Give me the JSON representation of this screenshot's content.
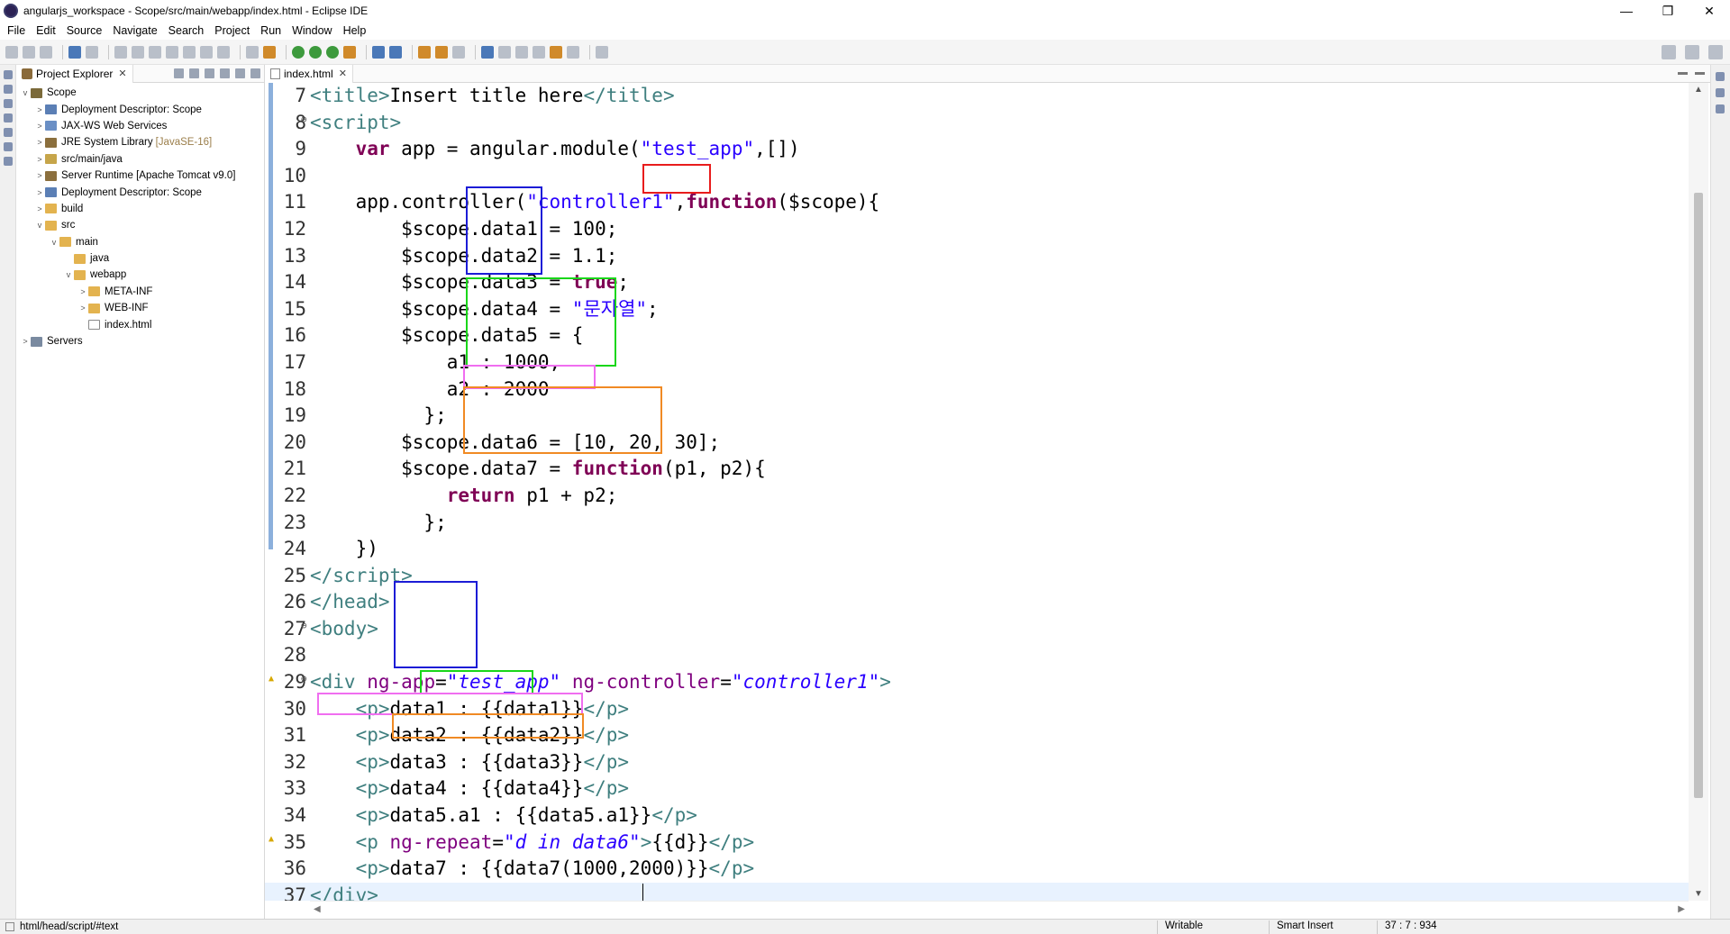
{
  "window": {
    "title": "angularjs_workspace - Scope/src/main/webapp/index.html - Eclipse IDE",
    "controls": [
      "minimize-icon",
      "restore-icon",
      "close-icon"
    ]
  },
  "menu": [
    "File",
    "Edit",
    "Source",
    "Navigate",
    "Search",
    "Project",
    "Run",
    "Window",
    "Help"
  ],
  "explorer": {
    "tab_label": "Project Explorer",
    "tree": [
      {
        "label": "Scope",
        "icon": "project-icon",
        "depth": 0,
        "expand": "v"
      },
      {
        "label": "Deployment Descriptor: Scope",
        "icon": "descriptor-icon",
        "depth": 1,
        "expand": ">"
      },
      {
        "label": "JAX-WS Web Services",
        "icon": "webservice-icon",
        "depth": 1,
        "expand": ">"
      },
      {
        "label": "JRE System Library",
        "suffix": "[JavaSE-16]",
        "icon": "library-icon",
        "depth": 1,
        "expand": ">"
      },
      {
        "label": "src/main/java",
        "icon": "source-folder-icon",
        "depth": 1,
        "expand": ">"
      },
      {
        "label": "Server Runtime [Apache Tomcat v9.0]",
        "icon": "library-icon",
        "depth": 1,
        "expand": ">"
      },
      {
        "label": "Deployment Descriptor: Scope",
        "icon": "descriptor-icon",
        "depth": 1,
        "expand": ">"
      },
      {
        "label": "build",
        "icon": "folder-icon",
        "depth": 1,
        "expand": ">"
      },
      {
        "label": "src",
        "icon": "folder-icon",
        "depth": 1,
        "expand": "v"
      },
      {
        "label": "main",
        "icon": "folder-icon",
        "depth": 2,
        "expand": "v"
      },
      {
        "label": "java",
        "icon": "folder-icon",
        "depth": 3,
        "expand": ""
      },
      {
        "label": "webapp",
        "icon": "folder-icon",
        "depth": 3,
        "expand": "v"
      },
      {
        "label": "META-INF",
        "icon": "folder-icon",
        "depth": 4,
        "expand": ">"
      },
      {
        "label": "WEB-INF",
        "icon": "folder-icon",
        "depth": 4,
        "expand": ">"
      },
      {
        "label": "index.html",
        "icon": "file-icon",
        "depth": 4,
        "expand": ""
      },
      {
        "label": "Servers",
        "icon": "server-icon",
        "depth": 0,
        "expand": ">"
      }
    ]
  },
  "editor": {
    "tab_label": "index.html",
    "lines": [
      {
        "n": "7",
        "html": "<span class=\"tag\">&lt;title&gt;</span>Insert title here<span class=\"tag\">&lt;/title&gt;</span>"
      },
      {
        "n": "8",
        "fold": true,
        "html": "<span class=\"tag\">&lt;script&gt;</span>"
      },
      {
        "n": "9",
        "html": "    <span class=\"kw\">var</span> app = angular.module(<span class=\"str\">\"test_app\"</span>,[])"
      },
      {
        "n": "10",
        "html": ""
      },
      {
        "n": "11",
        "html": "    app.controller(<span class=\"str\">\"controller1\"</span>,<span class=\"kw\">function</span>($scope){"
      },
      {
        "n": "12",
        "html": "        $scope.data1 = 100;"
      },
      {
        "n": "13",
        "html": "        $scope.data2 = 1.1;"
      },
      {
        "n": "14",
        "html": "        $scope.data3 = <span class=\"kw\">true</span>;"
      },
      {
        "n": "15",
        "html": "        $scope.data4 = <span class=\"str\">\"문자열\"</span>;"
      },
      {
        "n": "16",
        "html": "        $scope.data5 = {"
      },
      {
        "n": "17",
        "html": "            a1 : 1000,"
      },
      {
        "n": "18",
        "html": "            a2 : 2000"
      },
      {
        "n": "19",
        "html": "          };"
      },
      {
        "n": "20",
        "html": "        $scope.data6 = [10, 20, 30];"
      },
      {
        "n": "21",
        "html": "        $scope.data7 = <span class=\"kw\">function</span>(p1, p2){"
      },
      {
        "n": "22",
        "html": "            <span class=\"kw\">return</span> p1 + p2;"
      },
      {
        "n": "23",
        "html": "          };"
      },
      {
        "n": "24",
        "html": "    })"
      },
      {
        "n": "25",
        "html": "<span class=\"tag\">&lt;/script&gt;</span>"
      },
      {
        "n": "26",
        "html": "<span class=\"tag\">&lt;/head&gt;</span>"
      },
      {
        "n": "27",
        "fold": true,
        "html": "<span class=\"tag\">&lt;body&gt;</span>"
      },
      {
        "n": "28",
        "html": ""
      },
      {
        "n": "29",
        "fold": true,
        "warn": true,
        "html": "<span class=\"tag\">&lt;div</span> <span class=\"attr\">ng-app</span>=<span class=\"aval\">\"test_app\"</span> <span class=\"attr\">ng-controller</span>=<span class=\"aval\">\"controller1\"</span><span class=\"tag\">&gt;</span>"
      },
      {
        "n": "30",
        "html": "    <span class=\"tag\">&lt;p&gt;</span>data1 : {{data1}}<span class=\"tag\">&lt;/p&gt;</span>"
      },
      {
        "n": "31",
        "html": "    <span class=\"tag\">&lt;p&gt;</span>data2 : {{data2}}<span class=\"tag\">&lt;/p&gt;</span>"
      },
      {
        "n": "32",
        "html": "    <span class=\"tag\">&lt;p&gt;</span>data3 : {{data3}}<span class=\"tag\">&lt;/p&gt;</span>"
      },
      {
        "n": "33",
        "html": "    <span class=\"tag\">&lt;p&gt;</span>data4 : {{data4}}<span class=\"tag\">&lt;/p&gt;</span>"
      },
      {
        "n": "34",
        "html": "    <span class=\"tag\">&lt;p&gt;</span>data5.a1 : {{data5.a1}}<span class=\"tag\">&lt;/p&gt;</span>"
      },
      {
        "n": "35",
        "warn": true,
        "html": "    <span class=\"tag\">&lt;p</span> <span class=\"attr\">ng-repeat</span>=<span class=\"aval\">\"d in data6\"</span><span class=\"tag\">&gt;</span>{{d}}<span class=\"tag\">&lt;/p&gt;</span>"
      },
      {
        "n": "36",
        "html": "    <span class=\"tag\">&lt;p&gt;</span>data7 : {{data7(1000,2000)}}<span class=\"tag\">&lt;/p&gt;</span>"
      },
      {
        "n": "37",
        "current": true,
        "html": "<span class=\"tag\">&lt;/div&gt;</span>"
      }
    ]
  },
  "highlight_colors": {
    "primitive_values": "#1c1cd6",
    "object_value": "#19d619",
    "array_value": "#f06ef0",
    "function_value": "#f08a24",
    "scope_parameter": "#e81c1c"
  },
  "status": {
    "path": "html/head/script/#text",
    "mode": "Writable",
    "insert": "Smart Insert",
    "position": "37 : 7 : 934"
  }
}
